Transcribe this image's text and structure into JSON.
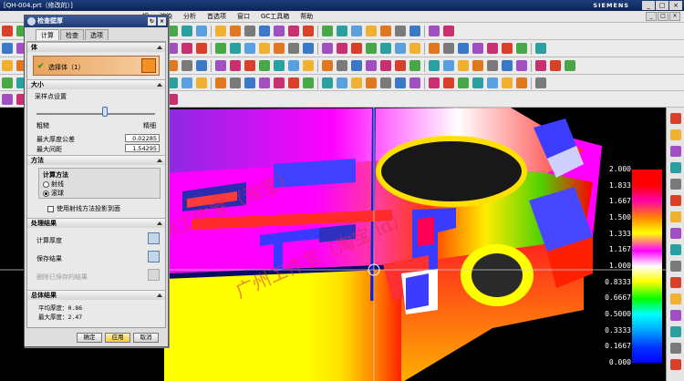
{
  "window": {
    "title": "[QH-004.prt（修改的）]",
    "brand": "SIEMENS"
  },
  "menu": [
    "视",
    "渲染",
    "分析",
    "首选项",
    "窗口",
    "GC工具箱",
    "帮助"
  ],
  "window_controls": [
    "_",
    "□",
    "×"
  ],
  "dialog": {
    "title": "检查壁厚",
    "tabs": [
      "计算",
      "检查",
      "选项"
    ],
    "body_section": "体",
    "select_body": "选择体（1）",
    "size_section": "大小",
    "sample_label": "采样点设置",
    "coarse": "粗糙",
    "fine": "精细",
    "sample_level": 0.58,
    "max_tol_label": "最大厚度公差",
    "max_tol_value": "0.02285",
    "max_gap_label": "最大间距",
    "max_gap_value": "1.54295",
    "method_section": "方法",
    "calc_method_label": "计算方法",
    "ray": "射线",
    "rolling_ball": "滚球",
    "selected_method": "滚球",
    "use_normal": "使用射线方法投影到面",
    "processing_section": "处理结果",
    "calc_thickness": "计算厚度",
    "save_result": "保存结果",
    "delete_saved": "删除已保存的结果",
    "summary_section": "总体结果",
    "avg_label": "平均厚度：",
    "avg_value": "0.86",
    "max_label": "最大厚度：",
    "max_value": "2.47",
    "ok": "确定",
    "apply": "应用",
    "cancel": "取消"
  },
  "legend": [
    "2.000",
    "1.833",
    "1.667",
    "1.500",
    "1.333",
    "1.167",
    "1.000",
    "0.8333",
    "0.6667",
    "0.5000",
    "0.3333",
    "0.1667",
    "0.000"
  ],
  "watermarks": [
    "广州工作室（淘宝）",
    "广州工作室（淘宝 id）"
  ],
  "colors": {
    "accent": "#f39222",
    "legend_top": "#ff0000",
    "legend_bottom": "#0000ff"
  }
}
